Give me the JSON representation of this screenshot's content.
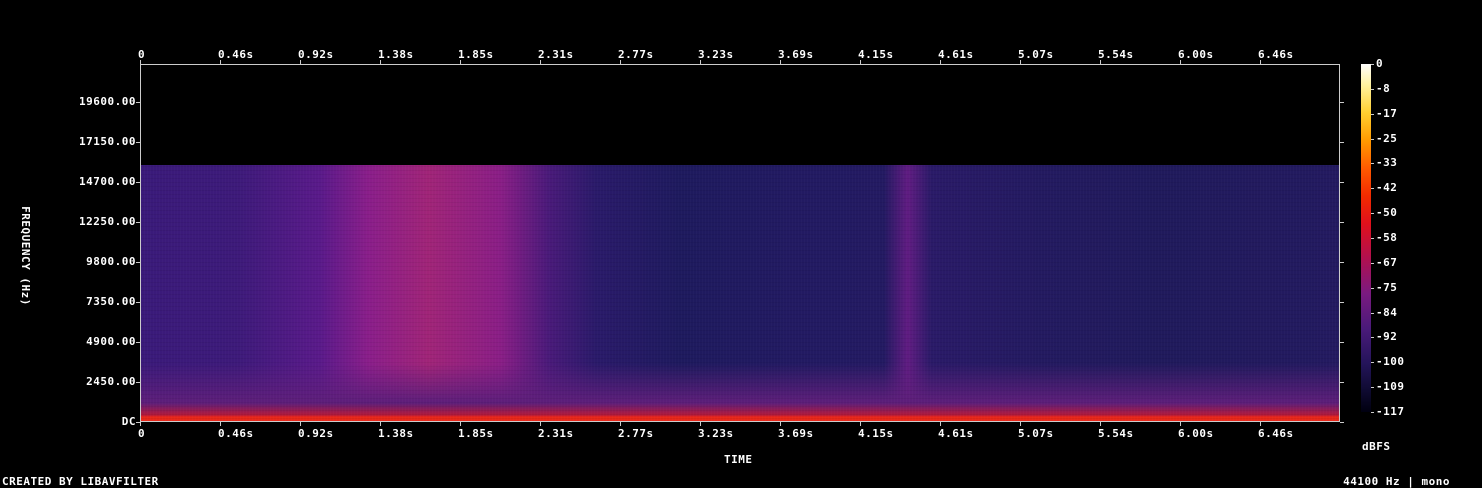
{
  "chart_data": {
    "type": "heatmap",
    "title": "",
    "xlabel": "TIME",
    "ylabel": "FREQUENCY (Hz)",
    "x_ticks": [
      "0",
      "0.46s",
      "0.92s",
      "1.38s",
      "1.85s",
      "2.31s",
      "2.77s",
      "3.23s",
      "3.69s",
      "4.15s",
      "4.61s",
      "5.07s",
      "5.54s",
      "6.00s",
      "6.46s"
    ],
    "y_ticks": [
      "DC",
      "2450.00",
      "4900.00",
      "7350.00",
      "9800.00",
      "12250.00",
      "14700.00",
      "17150.00",
      "19600.00"
    ],
    "x_range": [
      0,
      6.92
    ],
    "y_range": [
      0,
      22050
    ],
    "colorbar": {
      "label": "dBFS",
      "ticks": [
        "0",
        "-8",
        "-17",
        "-25",
        "-33",
        "-42",
        "-50",
        "-58",
        "-67",
        "-75",
        "-84",
        "-92",
        "-100",
        "-109",
        "-117"
      ],
      "range": [
        -117,
        0
      ]
    },
    "content_cutoff_hz": 15800,
    "colors": {
      "background": "#000000",
      "low": "#1e1a5e",
      "mid": "#8a1e8a",
      "high": "#e8281a",
      "peak": "#ffffff"
    }
  },
  "footer": {
    "left": "CREATED BY LIBAVFILTER",
    "right": "44100 Hz | mono"
  }
}
